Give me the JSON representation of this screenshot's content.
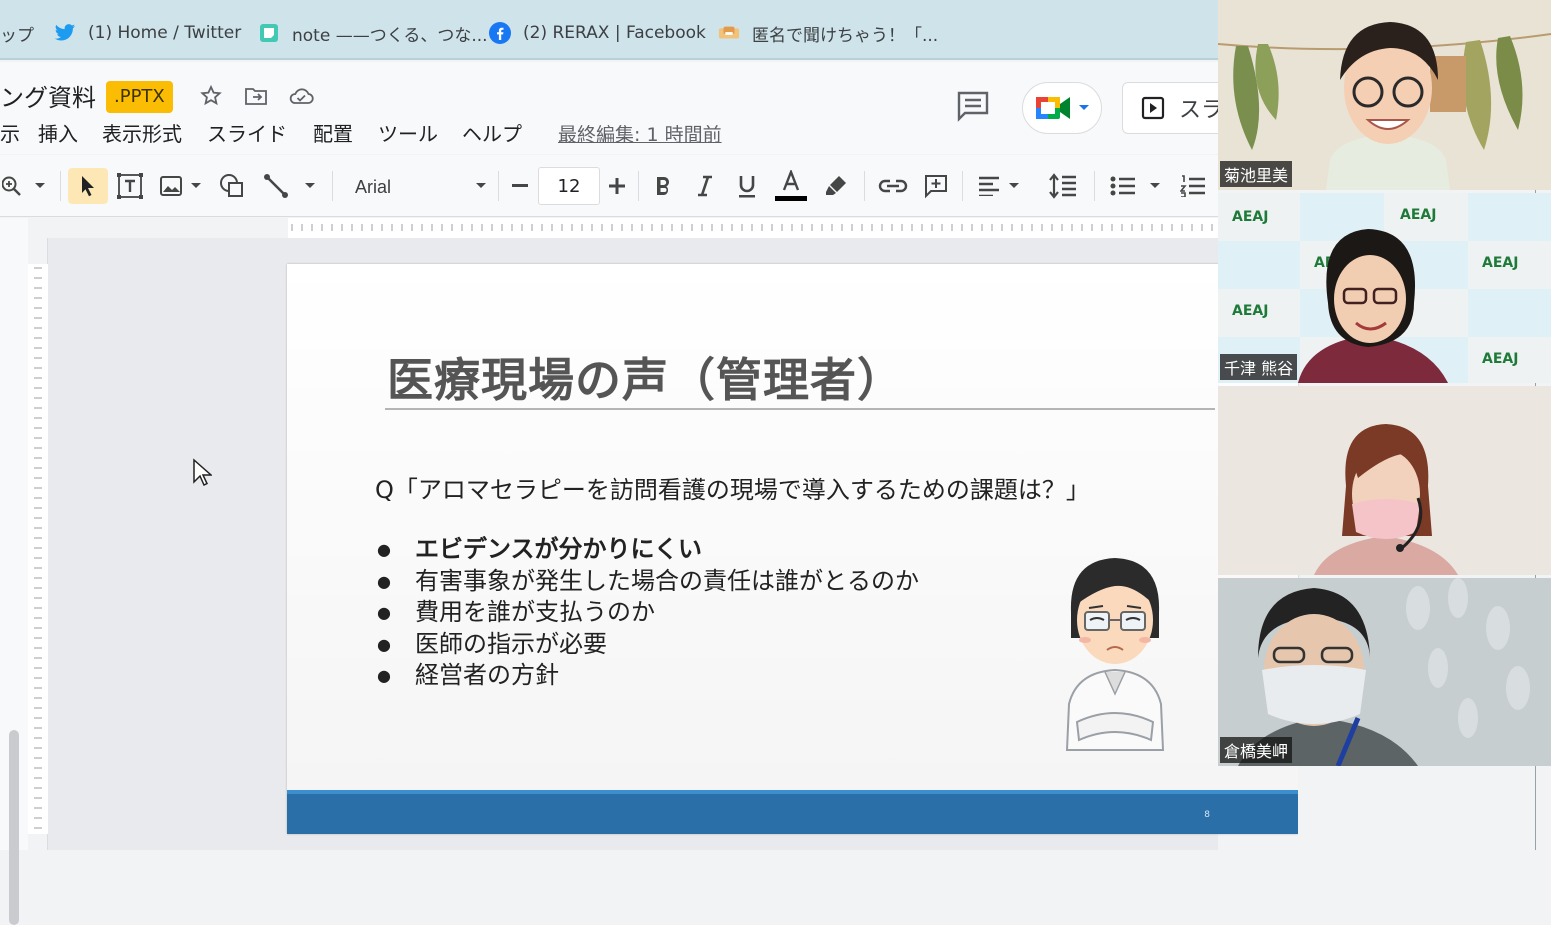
{
  "bookmarks": [
    {
      "label": "ップ",
      "icon": "app-icon"
    },
    {
      "label": "(1) Home / Twitter",
      "icon": "twitter-icon"
    },
    {
      "label": "note ——つくる、つな...",
      "icon": "note-icon"
    },
    {
      "label": "(2) RERAX | Facebook",
      "icon": "facebook-icon"
    },
    {
      "label": "匿名で聞けちゃう！「...",
      "icon": "handshake-icon"
    }
  ],
  "doc": {
    "title": "ング資料",
    "badge": ".PPTX",
    "last_edit": "最終編集: 1 時間前",
    "present_label": "スラ"
  },
  "menu": [
    "示",
    "挿入",
    "表示形式",
    "スライド",
    "配置",
    "ツール",
    "ヘルプ"
  ],
  "toolbar": {
    "font": "Arial",
    "font_size": "12"
  },
  "slide": {
    "title": "医療現場の声（管理者）",
    "question": "Q「アロマセラピーを訪問看護の現場で導入するための課題は？」",
    "bullets": [
      "エビデンスが分かりにくい",
      "有害事象が発生した場合の責任は誰がとるのか",
      "費用を誰が支払うのか",
      "医師の指示が必要",
      "経営者の方針"
    ],
    "page_number": "8",
    "footer_color": "#2a6fa8"
  },
  "participants": [
    {
      "name": "菊池里美"
    },
    {
      "name": "千津 熊谷"
    },
    {
      "name": ""
    },
    {
      "name": "倉橋美岬"
    }
  ],
  "logo_text": "AEAJ",
  "colors": {
    "badge": "#fbbc04",
    "bookmarks_bar": "#cfe3ea",
    "accent_blue": "#1a73e8"
  }
}
